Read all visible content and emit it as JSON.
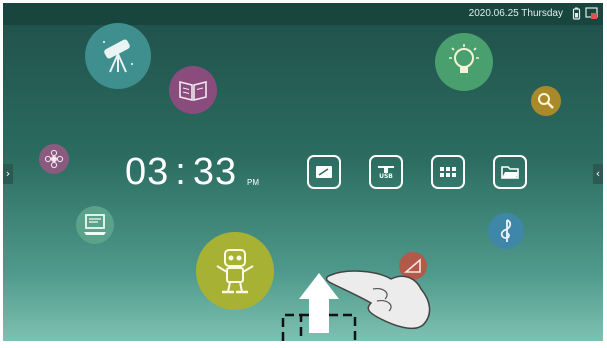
{
  "status_bar": {
    "datetime": "2020.06.25 Thursday",
    "icons": [
      "battery-icon",
      "screen-toggle-icon"
    ]
  },
  "clock": {
    "hours": "03",
    "separator": ":",
    "minutes": "33",
    "period": "PM"
  },
  "dock": {
    "items": [
      {
        "icon": "whiteboard-icon",
        "label": ""
      },
      {
        "icon": "usb-icon",
        "label": "USB"
      },
      {
        "icon": "apps-grid-icon",
        "label": ""
      },
      {
        "icon": "folder-icon",
        "label": ""
      }
    ]
  },
  "side_arrows": {
    "left": "›",
    "right": "‹"
  },
  "decor_bubbles": [
    {
      "icon": "telescope-icon",
      "color": "#3f8f8f"
    },
    {
      "icon": "book-icon",
      "color": "#8a4c7d"
    },
    {
      "icon": "lightbulb-icon",
      "color": "#49a06e"
    },
    {
      "icon": "magnifier-icon",
      "color": "#a88a2a"
    },
    {
      "icon": "flower-icon",
      "color": "#8a5b7f"
    },
    {
      "icon": "computer-icon",
      "color": "#5aa28a"
    },
    {
      "icon": "robot-icon",
      "color": "#a7b235"
    },
    {
      "icon": "music-note-icon",
      "color": "#3f87a8"
    },
    {
      "icon": "triangle-ruler-icon",
      "color": "#b25a4a"
    }
  ],
  "gesture_hint": {
    "icon": "swipe-up-hand-icon"
  }
}
